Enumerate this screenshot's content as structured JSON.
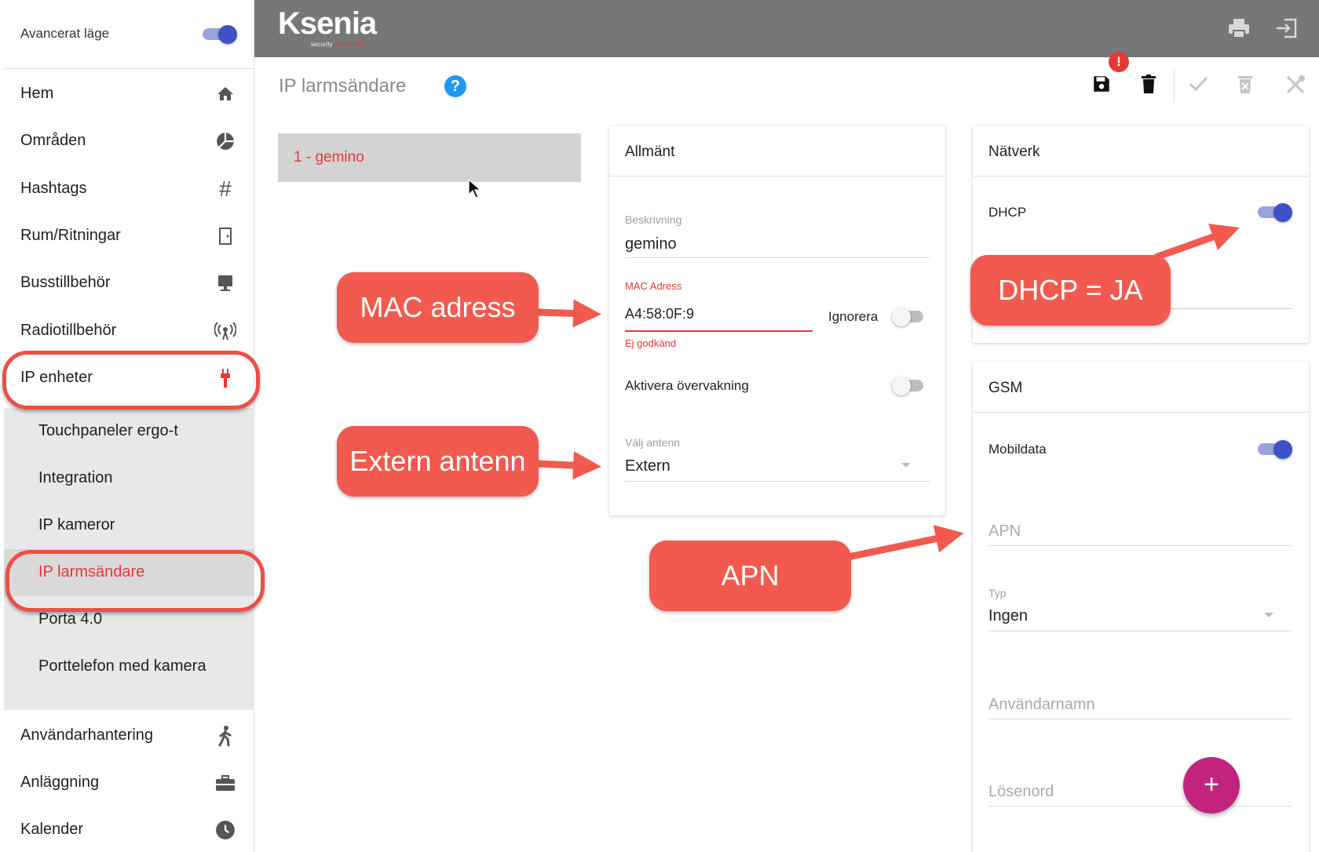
{
  "sidebar": {
    "advanced_mode_label": "Avancerat läge",
    "items": [
      {
        "label": "Hem",
        "icon": "home-icon"
      },
      {
        "label": "Områden",
        "icon": "pie-chart-icon"
      },
      {
        "label": "Hashtags",
        "icon": "hashtag-icon"
      },
      {
        "label": "Rum/Ritningar",
        "icon": "door-icon"
      },
      {
        "label": "Busstillbehör",
        "icon": "monitor-icon"
      },
      {
        "label": "Radiotillbehör",
        "icon": "radio-signal-icon"
      },
      {
        "label": "IP enheter",
        "icon": "plug-icon"
      }
    ],
    "subitems": [
      {
        "label": "Touchpaneler ergo-t"
      },
      {
        "label": "Integration"
      },
      {
        "label": "IP kameror"
      },
      {
        "label": "IP larmsändare"
      },
      {
        "label": "Porta 4.0"
      },
      {
        "label": "Porttelefon med kamera"
      }
    ],
    "bottom_items": [
      {
        "label": "Användarhantering",
        "icon": "person-walking-icon"
      },
      {
        "label": "Anläggning",
        "icon": "briefcase-icon"
      },
      {
        "label": "Kalender",
        "icon": "clock-icon"
      }
    ]
  },
  "header": {
    "logo_text": "Ksenia",
    "logo_sub": "security",
    "logo_sub_red": "innovation"
  },
  "page": {
    "title": "IP larmsändare",
    "help": "?",
    "badge": "!"
  },
  "list": {
    "item": "1 - gemino"
  },
  "general": {
    "title": "Allmänt",
    "description_label": "Beskrivning",
    "description_value": "gemino",
    "mac_label": "MAC Adress",
    "mac_value": "A4:58:0F:9",
    "ignore_label": "Ignorera",
    "mac_error": "Ej godkänd",
    "monitoring_label": "Aktivera övervakning",
    "antenna_label": "Välj antenn",
    "antenna_value": "Extern"
  },
  "network": {
    "title": "Nätverk",
    "dhcp_label": "DHCP"
  },
  "gsm": {
    "title": "GSM",
    "mobile_data_label": "Mobildata",
    "apn_placeholder": "APN",
    "type_label": "Typ",
    "type_value": "Ingen",
    "username_placeholder": "Användarnamn",
    "password_placeholder": "Lösenord"
  },
  "callouts": {
    "mac": "MAC adress",
    "antenna": "Extern antenn",
    "apn": "APN",
    "dhcp": "DHCP = JA"
  },
  "fab": "+",
  "colors": {
    "accent_red": "#e53935",
    "callout_red": "#f25a4f",
    "toggle_blue": "#3f51c6",
    "fab_magenta": "#c2237f",
    "topbar_gray": "#777777"
  }
}
